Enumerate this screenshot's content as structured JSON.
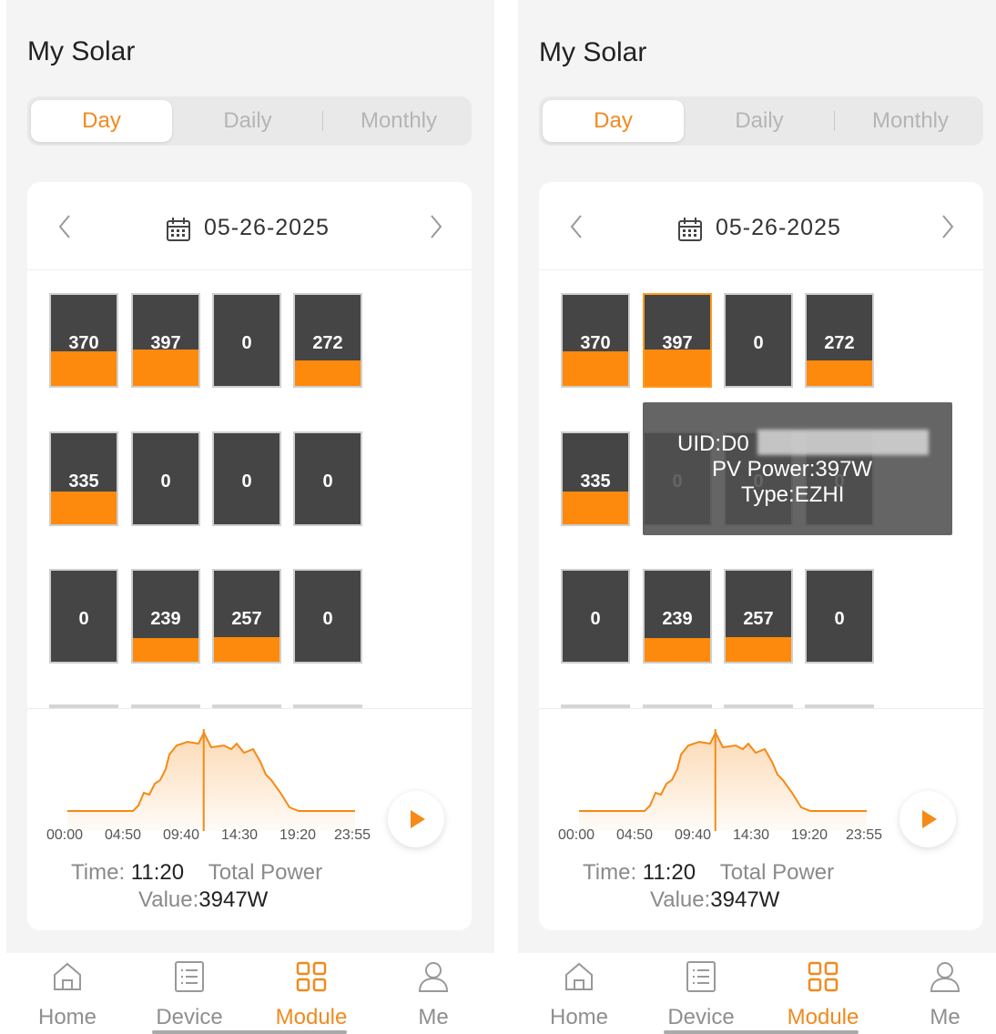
{
  "app": {
    "title": "My Solar"
  },
  "segments": {
    "day": "Day",
    "daily": "Daily",
    "monthly": "Monthly"
  },
  "date": {
    "value": "05-26-2025"
  },
  "panels": [
    {
      "value": "370",
      "fill": 0.38
    },
    {
      "value": "397",
      "fill": 0.4
    },
    {
      "value": "0",
      "fill": 0
    },
    {
      "value": "272",
      "fill": 0.28
    },
    {
      "value": "335",
      "fill": 0.36
    },
    {
      "value": "0",
      "fill": 0
    },
    {
      "value": "0",
      "fill": 0
    },
    {
      "value": "0",
      "fill": 0
    },
    {
      "value": "0",
      "fill": 0
    },
    {
      "value": "239",
      "fill": 0.26
    },
    {
      "value": "257",
      "fill": 0.27
    },
    {
      "value": "0",
      "fill": 0
    }
  ],
  "chart_data": {
    "type": "area",
    "xticks": [
      "00:00",
      "04:50",
      "09:40",
      "14:30",
      "19:20",
      "23:55"
    ],
    "color": "#f58a16",
    "cursor_time": "11:20"
  },
  "info": {
    "time_label": "Time:",
    "time_value": "11:20",
    "total_power_label": "Total Power",
    "value_label": "Value:",
    "value": "3947W"
  },
  "tooltip": {
    "uid": "UID:D0",
    "pv_power": "PV Power:397W",
    "type": "Type:EZHI"
  },
  "tabbar": [
    {
      "label": "Home",
      "icon": "home-icon"
    },
    {
      "label": "Device",
      "icon": "device-list-icon"
    },
    {
      "label": "Module",
      "icon": "module-grid-icon",
      "active": true
    },
    {
      "label": "Me",
      "icon": "user-icon"
    }
  ],
  "colors": {
    "accent": "#f08a1f",
    "panel": "#454545",
    "panel_fill": "#fd8a0c"
  }
}
